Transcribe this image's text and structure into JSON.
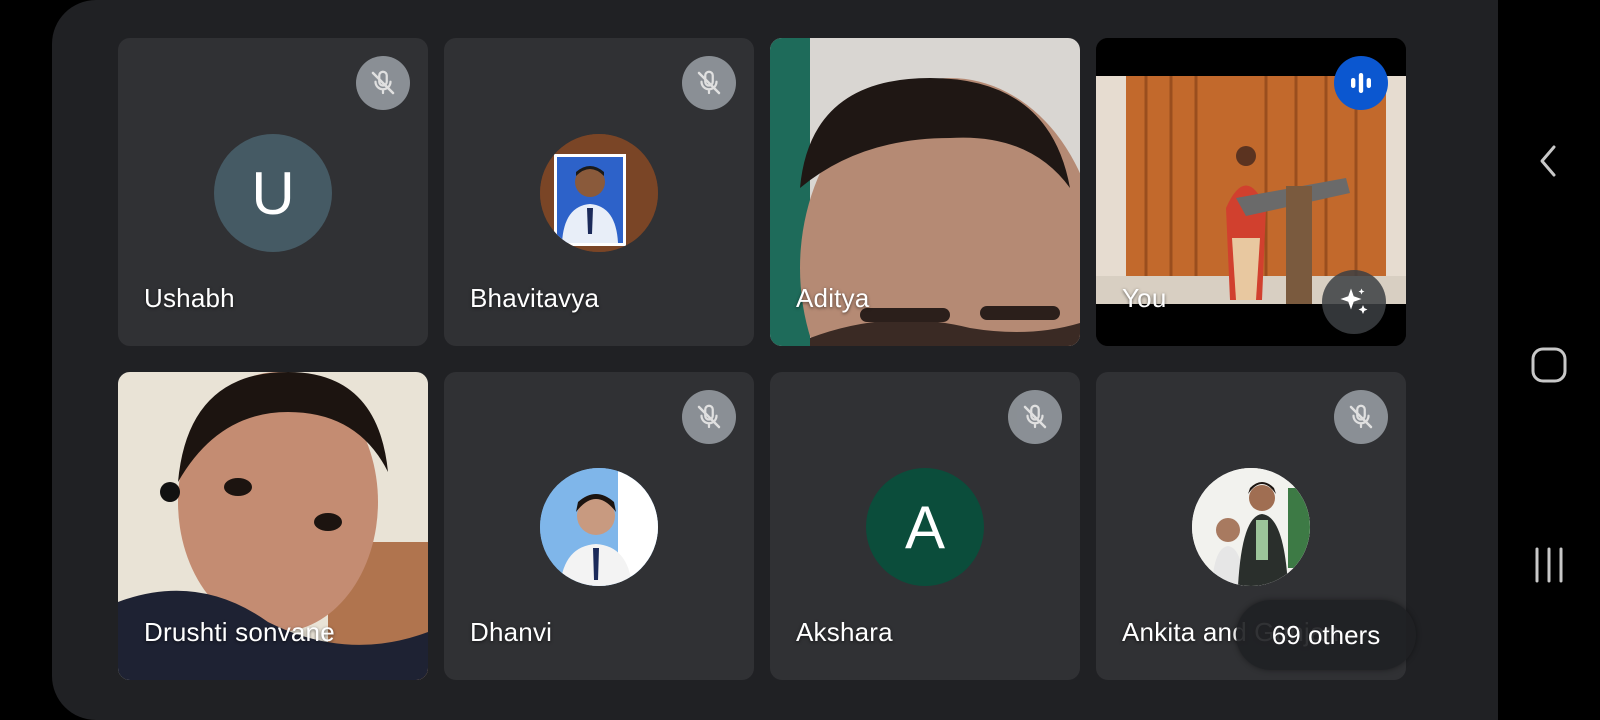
{
  "participants": [
    {
      "name": "Ushabh",
      "avatar_letter": "U",
      "avatar_color": "#455a64",
      "muted": true
    },
    {
      "name": "Bhavitavya",
      "muted": true
    },
    {
      "name": "Aditya",
      "muted": false
    },
    {
      "name": "You",
      "speaking": true
    },
    {
      "name": "Drushti sonvane",
      "muted": false
    },
    {
      "name": "Dhanvi",
      "muted": true
    },
    {
      "name": "Akshara",
      "avatar_letter": "A",
      "avatar_color": "#0b4d3b",
      "muted": true
    },
    {
      "name": "Ankita and Gunjan",
      "muted": true
    }
  ],
  "others_label": "69 others",
  "icons": {
    "mute": "mic-off-icon",
    "speaking": "audio-bars-icon",
    "effects": "sparkle-icon",
    "nav_back": "chevron-left-icon",
    "nav_home": "rounded-square-icon",
    "nav_recent": "three-bars-icon"
  },
  "colors": {
    "background": "#202124",
    "tile": "#303134",
    "speaking_accent": "#0b57d0"
  }
}
